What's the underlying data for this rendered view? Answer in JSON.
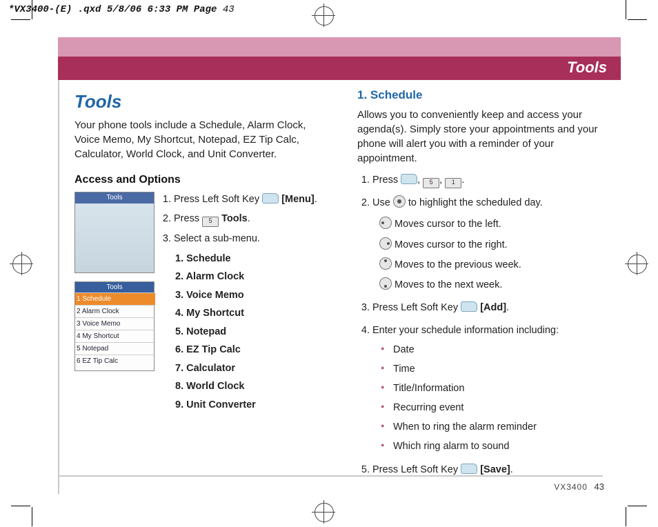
{
  "meta_header": {
    "bold": "*VX3400-(E) .qxd  5/8/06  6:33 PM  Page",
    "page": "43"
  },
  "title_bar": "Tools",
  "left": {
    "heading": "Tools",
    "intro": "Your phone tools include a Schedule, Alarm Clock, Voice Memo, My Shortcut, Notepad, EZ Tip Calc, Calculator, World Clock, and Unit Converter.",
    "subhead": "Access and Options",
    "screenshot_title": "Tools",
    "menu_rows": [
      "1 Schedule",
      "2 Alarm Clock",
      "3 Voice Memo",
      "4 My Shortcut",
      "5 Notepad",
      "6 EZ Tip Calc"
    ],
    "steps": {
      "s1a": "Press Left Soft Key ",
      "s1b": "[Menu]",
      "s1c": ".",
      "s2a": "Press ",
      "s2b": "Tools",
      "s2c": ".",
      "s3": "Select a sub-menu."
    },
    "submenu": [
      "1. Schedule",
      "2. Alarm Clock",
      "3. Voice Memo",
      "4. My Shortcut",
      "5. Notepad",
      "6. EZ Tip Calc",
      "7. Calculator",
      "8. World Clock",
      "9. Unit Converter"
    ]
  },
  "right": {
    "heading": "1. Schedule",
    "intro": "Allows you to conveniently keep and access your agenda(s). Simply store your appointments and your phone will alert you with a reminder of your appointment.",
    "r1a": "Press ",
    "r1b": ", ",
    "r1c": ", ",
    "r1d": ".",
    "r2a": "Use ",
    "r2b": " to highlight the scheduled day.",
    "nav": {
      "left": "Moves cursor to the left.",
      "right": "Moves cursor to the right.",
      "up": "Moves to the previous week.",
      "down": "Moves to the next week."
    },
    "r3a": "Press Left Soft Key ",
    "r3b": "[Add]",
    "r3c": ".",
    "r4": "Enter your schedule information including:",
    "bullets": [
      "Date",
      "Time",
      "Title/Information",
      "Recurring event",
      "When to ring the alarm reminder",
      "Which ring alarm to sound"
    ],
    "r5a": "Press Left Soft Key ",
    "r5b": "[Save]",
    "r5c": "."
  },
  "footer": {
    "model": "VX3400",
    "page": "43"
  },
  "keys": {
    "five": "5",
    "one": "1"
  }
}
